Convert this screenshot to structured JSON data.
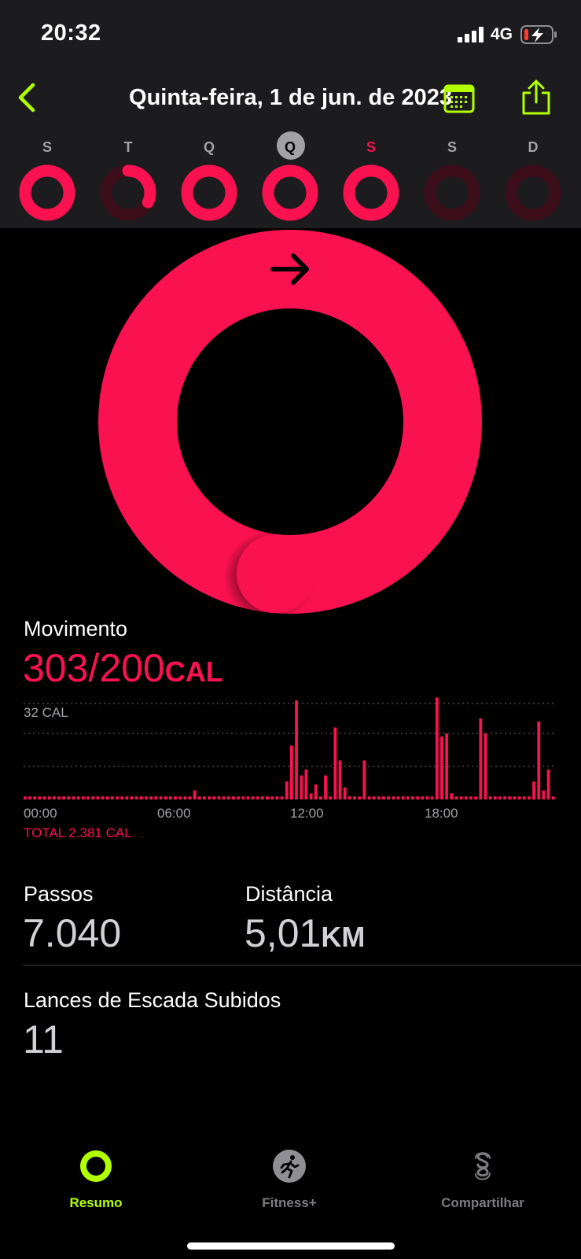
{
  "status": {
    "time": "20:32",
    "network": "4G"
  },
  "header": {
    "title": "Quinta-feira, 1 de jun. de 2023"
  },
  "week": {
    "days": [
      {
        "label": "S",
        "progress": 1.0
      },
      {
        "label": "T",
        "progress": 0.32
      },
      {
        "label": "Q",
        "progress": 1.0
      },
      {
        "label": "Q",
        "progress": 1.0,
        "selected": true
      },
      {
        "label": "S",
        "progress": 1.0,
        "today": true
      },
      {
        "label": "S",
        "progress": 0.0
      },
      {
        "label": "D",
        "progress": 0.0
      }
    ]
  },
  "ring": {
    "progress": 1.515,
    "color": "#fa114f"
  },
  "move": {
    "title": "Movimento",
    "value": "303/200",
    "unit": "CAL",
    "chart_max_label": "32 CAL",
    "ticks": [
      "00:00",
      "06:00",
      "12:00",
      "18:00"
    ],
    "total": "TOTAL 2.381 CAL"
  },
  "chart_data": {
    "type": "bar",
    "x": [
      "00:00",
      "00:20",
      "00:40",
      "01:00",
      "01:20",
      "01:40",
      "02:00",
      "02:20",
      "02:40",
      "03:00",
      "03:20",
      "03:40",
      "04:00",
      "04:20",
      "04:40",
      "05:00",
      "05:20",
      "05:40",
      "06:00",
      "06:20",
      "06:40",
      "07:00",
      "07:20",
      "07:40",
      "08:00",
      "08:20",
      "08:40",
      "09:00",
      "09:20",
      "09:40",
      "10:00",
      "10:20",
      "10:40",
      "11:00",
      "11:20",
      "11:40",
      "12:00",
      "12:20",
      "12:40",
      "13:00",
      "13:20",
      "13:40",
      "14:00",
      "14:20",
      "14:40",
      "15:00",
      "15:20",
      "15:40",
      "16:00",
      "16:20",
      "16:40",
      "17:00",
      "17:20",
      "17:40",
      "18:00",
      "18:20",
      "18:40",
      "19:00",
      "19:20",
      "19:40",
      "20:00",
      "20:20",
      "20:40",
      "21:00",
      "21:20",
      "21:40",
      "22:00",
      "22:20",
      "22:40",
      "23:00",
      "23:20",
      "23:40"
    ],
    "values": [
      1,
      1,
      1,
      1,
      1,
      1,
      1,
      1,
      1,
      1,
      1,
      1,
      1,
      1,
      1,
      1,
      1,
      1,
      1,
      1,
      1,
      1,
      1,
      1,
      1,
      1,
      1,
      1,
      1,
      1,
      1,
      1,
      1,
      1,
      1,
      3,
      1,
      1,
      1,
      1,
      1,
      1,
      1,
      1,
      1,
      1,
      1,
      1,
      1,
      1,
      1,
      1,
      1,
      1,
      6,
      18,
      33,
      8,
      10,
      2,
      5,
      1,
      8,
      1,
      24,
      13,
      4,
      1,
      1,
      1,
      13,
      1,
      1,
      1,
      1,
      1,
      1,
      1,
      1,
      1,
      1,
      1,
      1,
      1,
      1,
      34,
      21,
      22,
      2,
      1,
      1,
      1,
      1,
      1,
      27,
      22,
      1,
      1,
      1,
      1,
      1,
      1,
      1,
      1,
      1,
      6,
      26,
      3,
      10,
      1
    ],
    "ylim": [
      0,
      32
    ],
    "grid": true,
    "color": "#fa114f"
  },
  "stats": {
    "steps_title": "Passos",
    "steps_value": "7.040",
    "distance_title": "Distância",
    "distance_value": "5,01",
    "distance_unit": "KM",
    "floors_title": "Lances de Escada Subidos",
    "floors_value": "11"
  },
  "tabs": [
    {
      "label": "Resumo",
      "active": true
    },
    {
      "label": "Fitness+"
    },
    {
      "label": "Compartilhar"
    }
  ]
}
